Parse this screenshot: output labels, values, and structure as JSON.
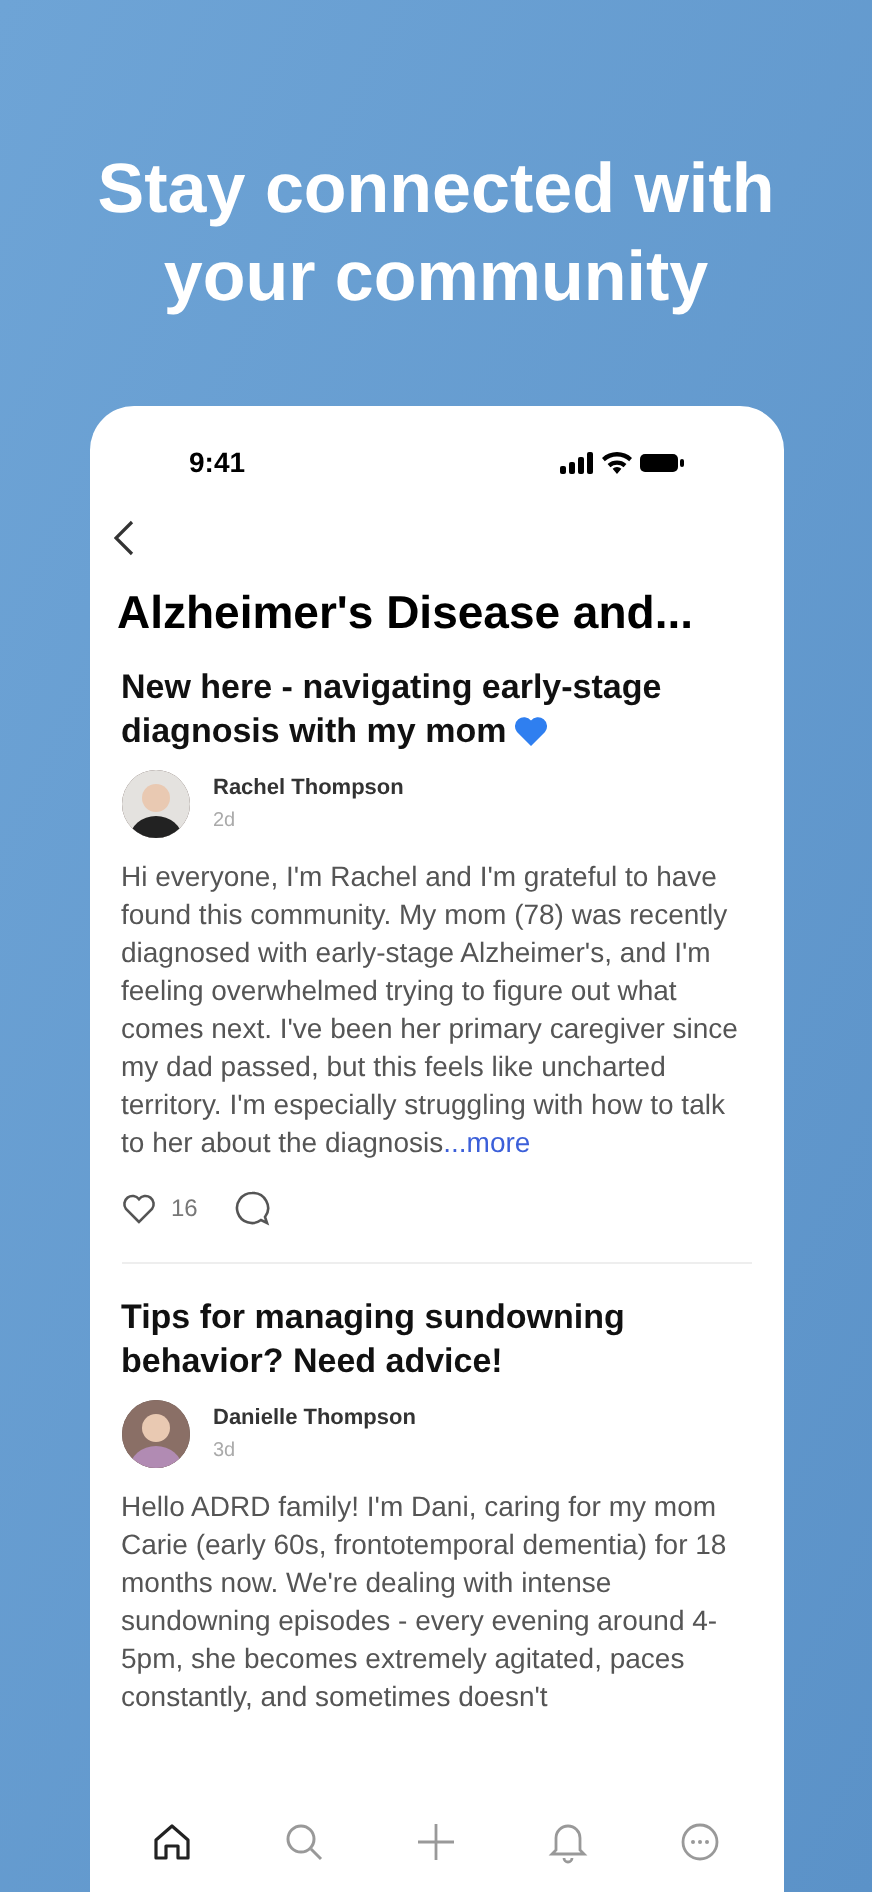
{
  "headline": "Stay connected with your community",
  "status_bar": {
    "time": "9:41"
  },
  "page_title": "Alzheimer's Disease and...",
  "posts": [
    {
      "title": "New here - navigating early-stage diagnosis with my mom",
      "heart_emoji": true,
      "author": "Rachel Thompson",
      "age": "2d",
      "body": "Hi everyone, I'm Rachel and I'm grateful to have found this community. My mom (78) was recently diagnosed with early-stage Alzheimer's, and I'm feeling overwhelmed trying to figure out what comes next. I've been her primary caregiver since my dad passed, but this feels like uncharted territory. I'm especially struggling with how to talk to her about the diagnosis",
      "more": "...more",
      "likes": "16"
    },
    {
      "title": "Tips for managing sundowning behavior? Need advice!",
      "heart_emoji": false,
      "author": "Danielle Thompson",
      "age": "3d",
      "body": "Hello ADRD family! I'm Dani, caring for my mom Carie (early 60s, frontotemporal dementia) for 18 months now. We're dealing with intense sundowning episodes - every evening around 4-5pm, she becomes extremely agitated, paces constantly, and sometimes doesn't"
    }
  ],
  "tab_bar": [
    {
      "kind": "home",
      "selected": true
    },
    {
      "kind": "search",
      "selected": false
    },
    {
      "kind": "add",
      "selected": false
    },
    {
      "kind": "notifications",
      "selected": false
    },
    {
      "kind": "messages",
      "selected": false
    }
  ]
}
